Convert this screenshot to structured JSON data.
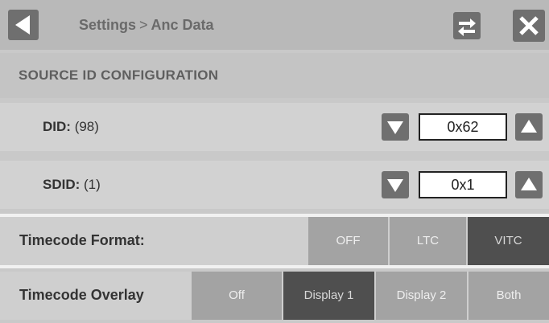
{
  "header": {
    "breadcrumb_parent": "Settings",
    "breadcrumb_separator": ">",
    "breadcrumb_current": "Anc Data"
  },
  "section": {
    "title": "SOURCE ID CONFIGURATION"
  },
  "did": {
    "label": "DID:",
    "decimal": "(98)",
    "value": "0x62"
  },
  "sdid": {
    "label": "SDID:",
    "decimal": "(1)",
    "value": "0x1"
  },
  "timecode_format": {
    "label": "Timecode Format:",
    "options": [
      "OFF",
      "LTC",
      "VITC"
    ],
    "selected": "VITC"
  },
  "timecode_overlay": {
    "label": "Timecode Overlay",
    "options": [
      "Off",
      "Display 1",
      "Display 2",
      "Both"
    ],
    "selected": "Display 1"
  },
  "icons": {
    "back": "back-arrow-icon",
    "swap": "swap-arrows-icon",
    "close": "close-icon",
    "decrement": "down-triangle-icon",
    "increment": "up-triangle-icon"
  }
}
